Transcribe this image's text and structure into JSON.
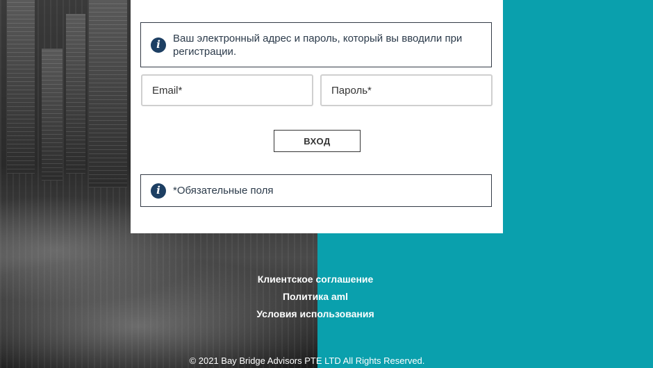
{
  "login_form": {
    "info_text": "Ваш электронный адрес и пароль, который вы вводили при регистрации.",
    "email_placeholder": "Email*",
    "password_placeholder": "Пароль*",
    "login_button": "ВХОД",
    "required_note": "*Обязательные поля"
  },
  "footer": {
    "links": [
      "Клиентское соглашение",
      "Политика aml",
      "Условия использования"
    ],
    "copyright": "© 2021 Bay Bridge Advisors PTE LTD All Rights Reserved."
  },
  "colors": {
    "accent_teal": "#0aa0ad",
    "info_icon": "#1d3f63"
  },
  "icons": {
    "info": "info-icon"
  }
}
